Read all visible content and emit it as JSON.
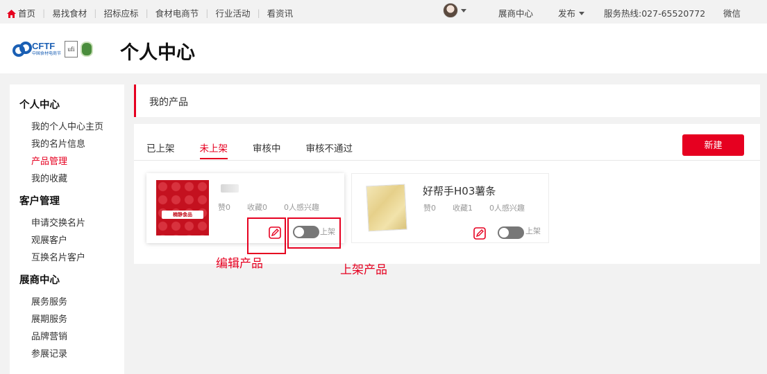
{
  "topnav": {
    "items": [
      "首页",
      "易找食材",
      "招标应标",
      "食材电商节",
      "行业活动",
      "看资讯"
    ],
    "exhibitor_center": "展商中心",
    "publish": "发布",
    "hotline": "服务热线:027-65520772",
    "wechat": "微信"
  },
  "header": {
    "logo_text": "CFTF",
    "logo_sub": "中国食材电商节",
    "logo_ufi": "ufi",
    "title": "个人中心"
  },
  "sidebar": {
    "groups": [
      {
        "title": "个人中心",
        "items": [
          "我的个人中心主页",
          "我的名片信息",
          "产品管理",
          "我的收藏"
        ]
      },
      {
        "title": "客户管理",
        "items": [
          "申请交换名片",
          "观展客户",
          "互换名片客户"
        ]
      },
      {
        "title": "展商中心",
        "items": [
          "展务服务",
          "展期服务",
          "品牌营销",
          "参展记录"
        ]
      }
    ]
  },
  "main": {
    "section_title": "我的产品",
    "tabs": [
      "已上架",
      "未上架",
      "审核中",
      "审核不通过"
    ],
    "new_button": "新建",
    "products": [
      {
        "name": "",
        "likes": "赞0",
        "favorites": "收藏0",
        "interest": "0人感兴趣",
        "toggle_label": "上架",
        "thumb_brand": "楠静食品"
      },
      {
        "name": "好帮手H03薯条",
        "likes": "赞0",
        "favorites": "收藏1",
        "interest": "0人感兴趣",
        "toggle_label": "上架"
      }
    ]
  },
  "annotations": {
    "edit": "编辑产品",
    "list": "上架产品"
  },
  "colors": {
    "accent": "#e60020",
    "brand_blue": "#1a5fb4"
  }
}
